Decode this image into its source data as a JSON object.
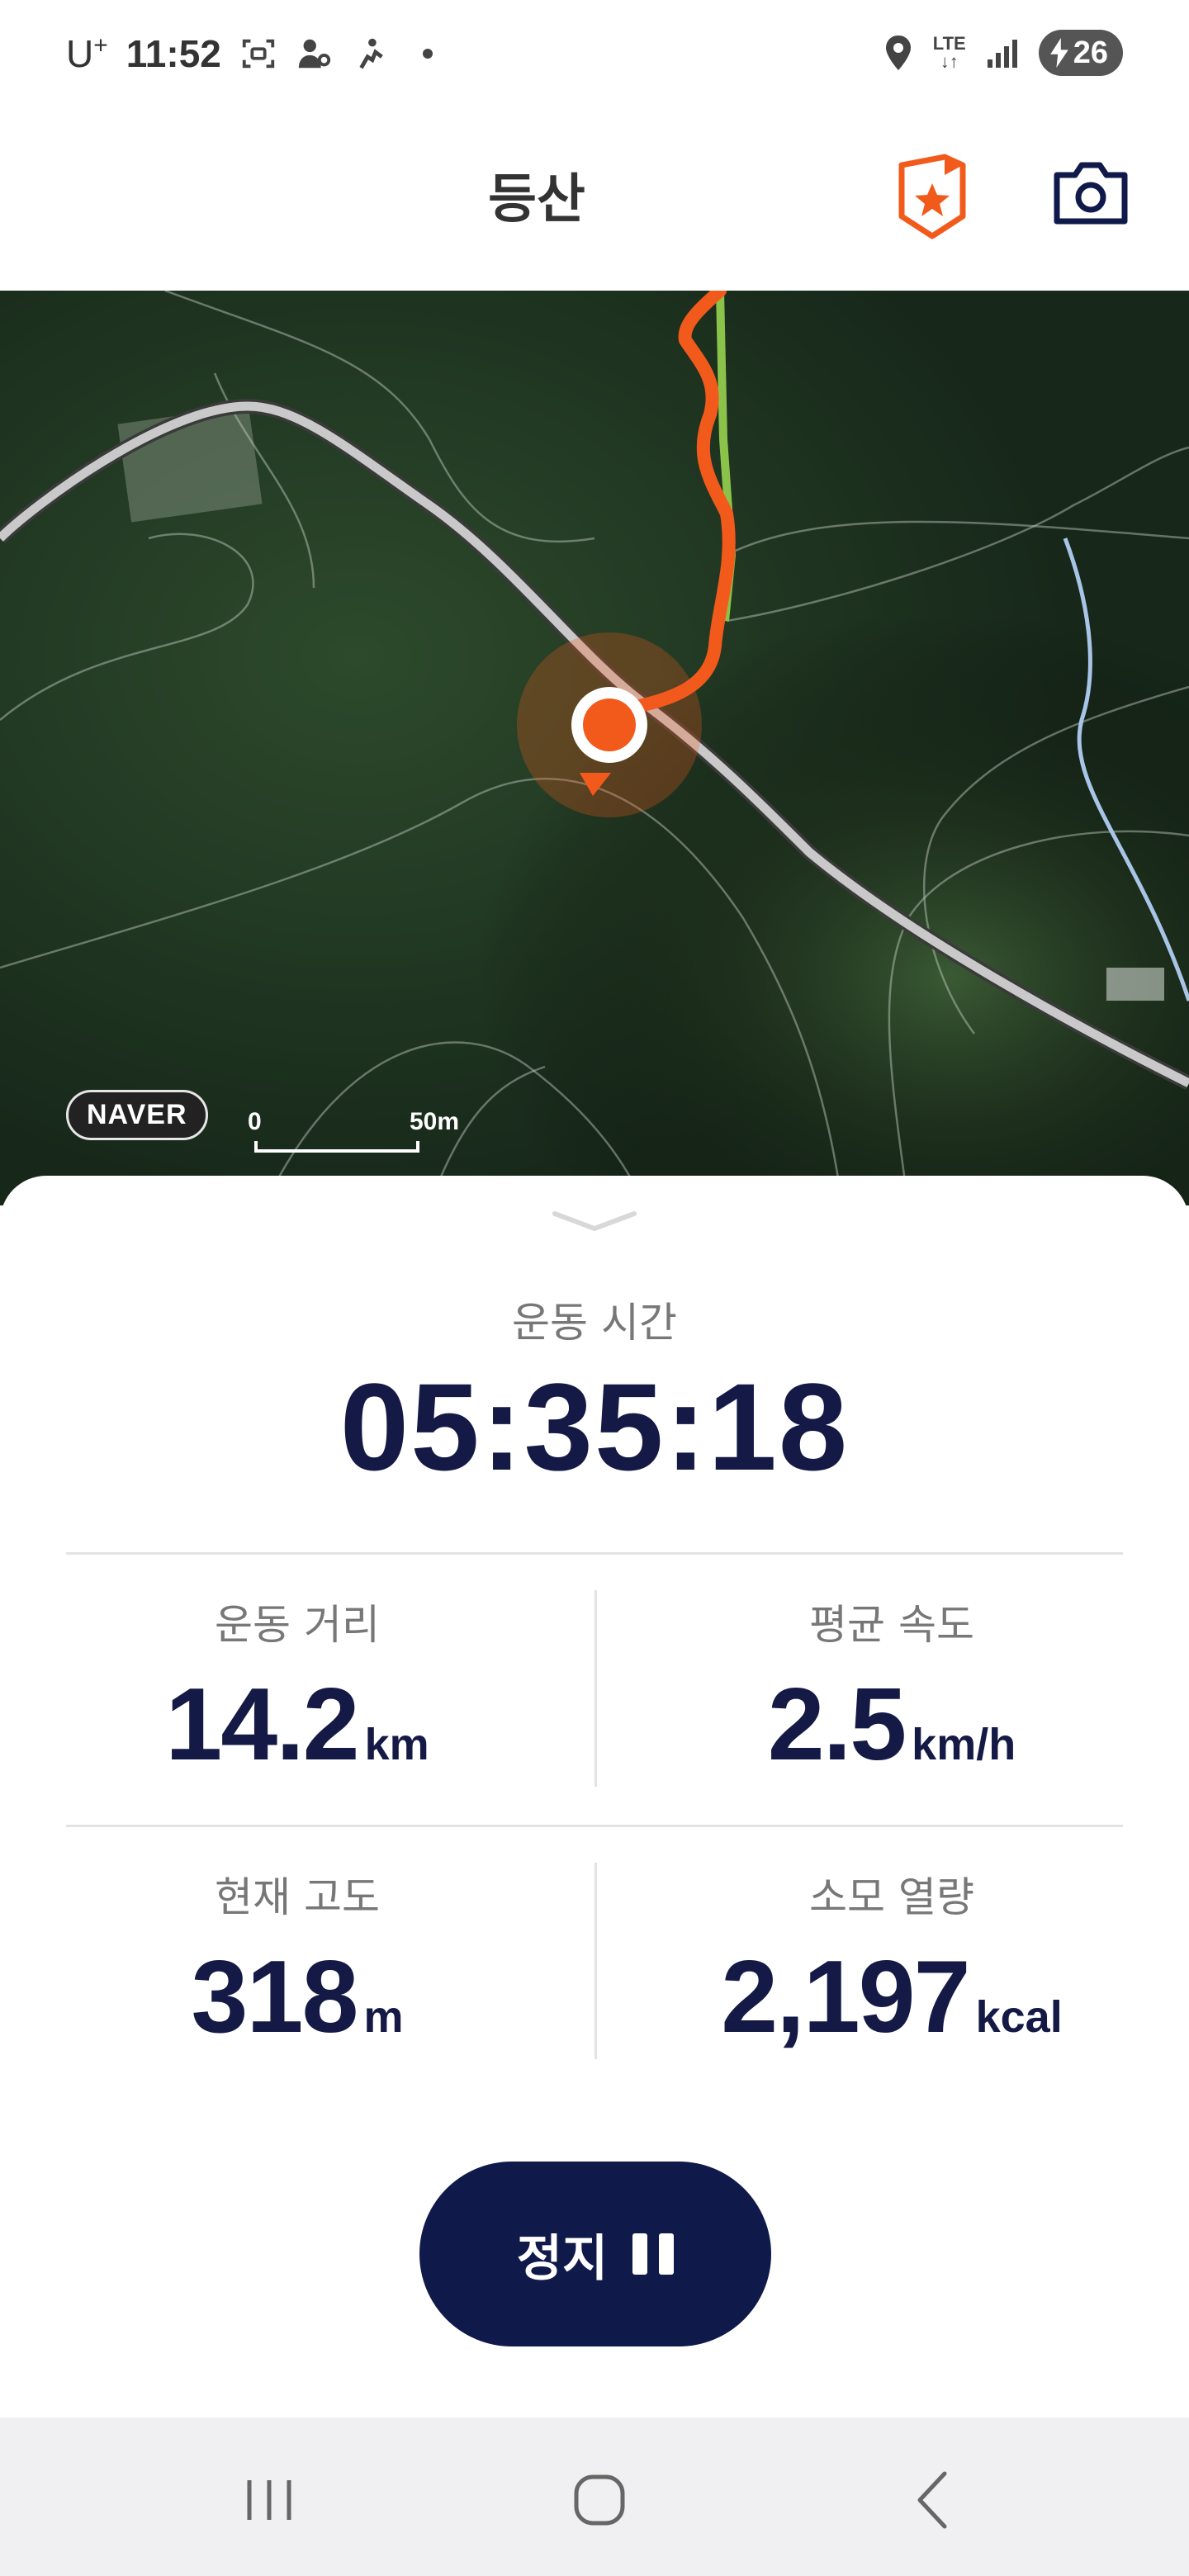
{
  "status_bar": {
    "carrier": "U",
    "carrier_sup": "+",
    "time": "11:52",
    "network": "LTE",
    "battery": "26"
  },
  "header": {
    "title": "등산",
    "icons": [
      "badge-icon",
      "camera-icon"
    ],
    "accent_color": "#f25a1c"
  },
  "map": {
    "provider": "NAVER",
    "scale_start": "0",
    "scale_end": "50m",
    "track_color": "#f25a1c"
  },
  "stats": {
    "elapsed_label": "운동 시간",
    "elapsed_value": "05:35:18",
    "items": [
      {
        "label": "운동 거리",
        "value": "14.2",
        "unit": "km"
      },
      {
        "label": "평균 속도",
        "value": "2.5",
        "unit": "km/h"
      },
      {
        "label": "현재 고도",
        "value": "318",
        "unit": "m"
      },
      {
        "label": "소모 열량",
        "value": "2,197",
        "unit": "kcal"
      }
    ]
  },
  "controls": {
    "stop_label": "정지",
    "primary_color": "#0f1a4a"
  },
  "nav_bar": {
    "icons": [
      "recent-apps-icon",
      "home-icon",
      "back-icon"
    ]
  }
}
